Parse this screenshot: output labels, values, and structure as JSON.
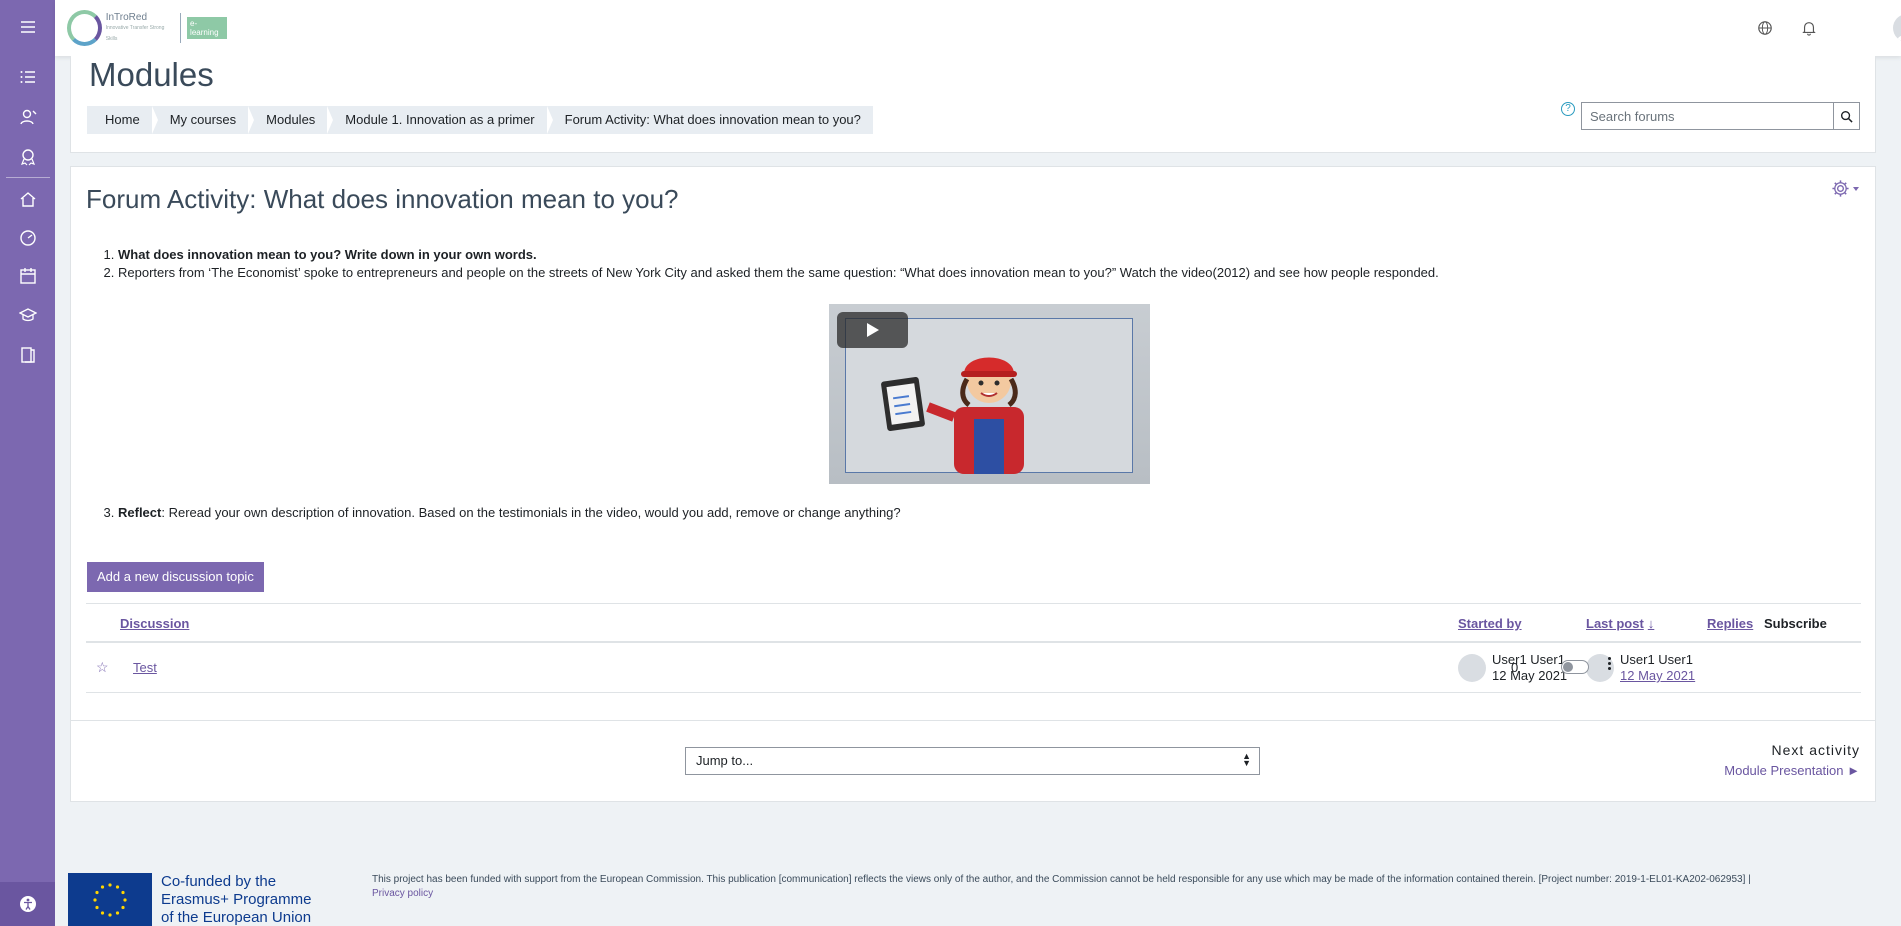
{
  "topbar": {
    "logo_text": "InTroRed",
    "logo_sub": "Innovative Transfer Strong Skills",
    "logo_badge": "e-learning"
  },
  "header": {
    "title": "Modules",
    "breadcrumb": [
      "Home",
      "My courses",
      "Modules",
      "Module 1. Innovation as a primer",
      "Forum Activity: What does innovation mean to you?"
    ],
    "search_placeholder": "Search forums"
  },
  "main": {
    "title": "Forum Activity: What does innovation mean to you?",
    "intro_items": [
      "What does innovation mean to you? Write down in your own words.",
      "Reporters from ‘The Economist’ spoke to entrepreneurs and people on the streets of New York City and asked them the same question: “What does innovation mean to you?” Watch the video(2012) and see how people responded."
    ],
    "reflect_label": "Reflect",
    "reflect_text": ": Reread your own description of innovation. Based on the testimonials in the video, would you add, remove or change anything?",
    "add_button": "Add a new discussion topic"
  },
  "table": {
    "headers": {
      "discussion": "Discussion",
      "started_by": "Started by",
      "last_post": "Last post",
      "replies": "Replies",
      "subscribe": "Subscribe"
    },
    "rows": [
      {
        "topic": "Test",
        "started_name": "User1 User1",
        "started_date": "12 May 2021",
        "last_name": "User1 User1",
        "last_date": "12 May 2021",
        "replies": "0"
      }
    ]
  },
  "nav": {
    "jump_to": "Jump to...",
    "next_label": "Next activity",
    "next_link": "Module Presentation ►"
  },
  "footer": {
    "eu_line1": "Co-funded by the",
    "eu_line2": "Erasmus+ Programme",
    "eu_line3": "of the European Union",
    "disclaimer": "This project has been funded with support from the European Commission. This publication [communication] reflects the views only of the author, and the Commission cannot be held responsible for any use which may be made of the information contained therein. [Project number: 2019-1-EL01-KA202-062953] |",
    "privacy": "Privacy policy"
  },
  "icons": {
    "sidebar": [
      "menu-icon",
      "list-icon",
      "user-icon",
      "badge-icon",
      "home-icon",
      "dashboard-icon",
      "calendar-icon",
      "courses-icon",
      "book-icon",
      "accessibility-icon"
    ],
    "top": [
      "language-icon",
      "bell-icon",
      "avatar"
    ]
  },
  "colors": {
    "brand": "#7c68b0",
    "link": "#6a56a0",
    "background": "#eef2f5"
  }
}
